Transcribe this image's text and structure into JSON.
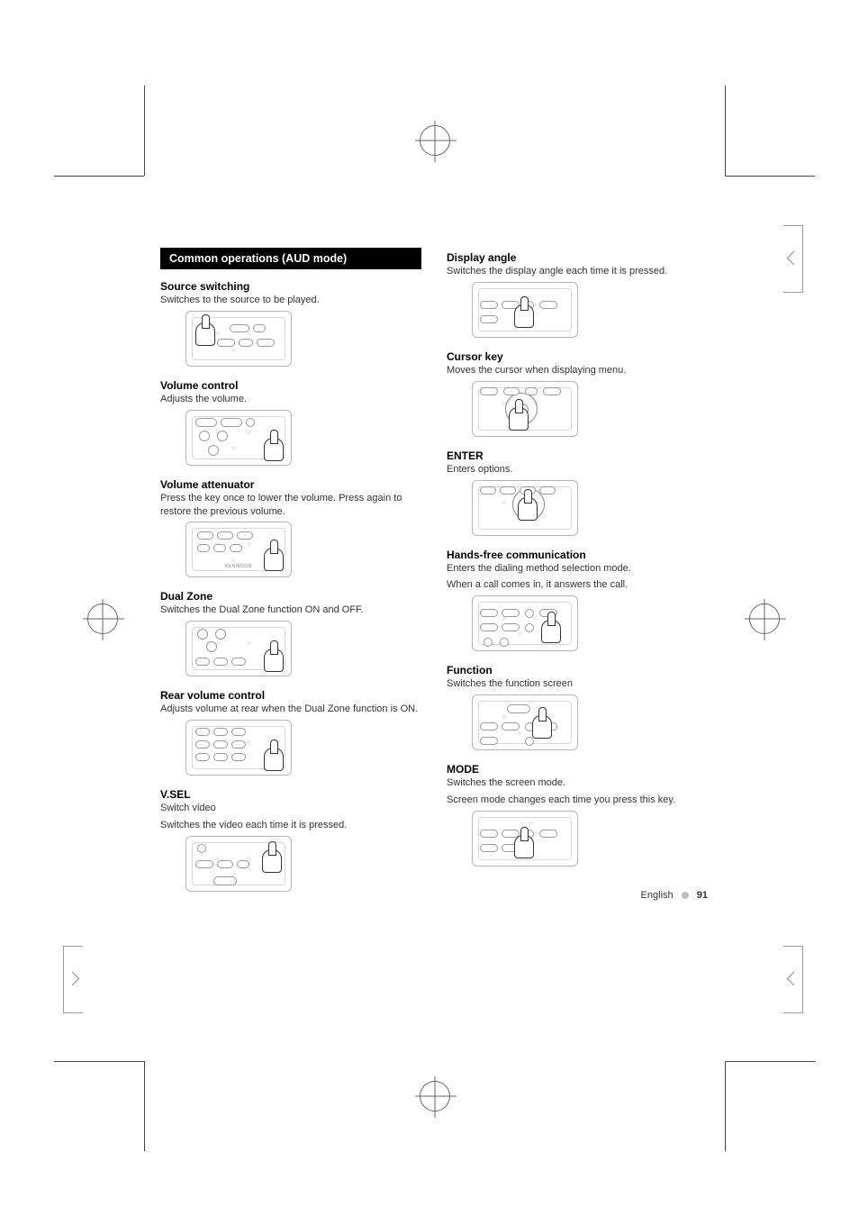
{
  "header_banner": "Common operations (AUD mode)",
  "left": {
    "source_switching": {
      "title": "Source switching",
      "desc": "Switches to the source to be played."
    },
    "volume_control": {
      "title": "Volume control",
      "desc": "Adjusts the volume."
    },
    "volume_attenuator": {
      "title": "Volume attenuator",
      "desc": "Press the key once to lower the volume. Press again to restore the previous volume."
    },
    "dual_zone": {
      "title": "Dual Zone",
      "desc": "Switches the Dual Zone function ON and OFF."
    },
    "rear_volume": {
      "title": "Rear volume control",
      "desc": "Adjusts volume at rear when the Dual Zone function is ON."
    },
    "vsel": {
      "title": "V.SEL",
      "sub": "Switch video",
      "desc": "Switches the video each time it is pressed."
    }
  },
  "right": {
    "display_angle": {
      "title": "Display angle",
      "desc": "Switches the display angle each time it is pressed."
    },
    "cursor_key": {
      "title": "Cursor key",
      "desc": "Moves the cursor when displaying menu."
    },
    "enter": {
      "title": "ENTER",
      "desc": "Enters options."
    },
    "hands_free": {
      "title": "Hands-free communication",
      "desc1": "Enters the dialing method selection mode.",
      "desc2": "When a call comes in, it answers the call."
    },
    "function": {
      "title": "Function",
      "desc": "Switches the function screen"
    },
    "mode": {
      "title": "MODE",
      "desc1": "Switches the screen mode.",
      "desc2": "Screen mode changes each time you press this key."
    }
  },
  "diagram_brand": "KENWOOD",
  "footer": {
    "lang": "English",
    "page": "91"
  }
}
